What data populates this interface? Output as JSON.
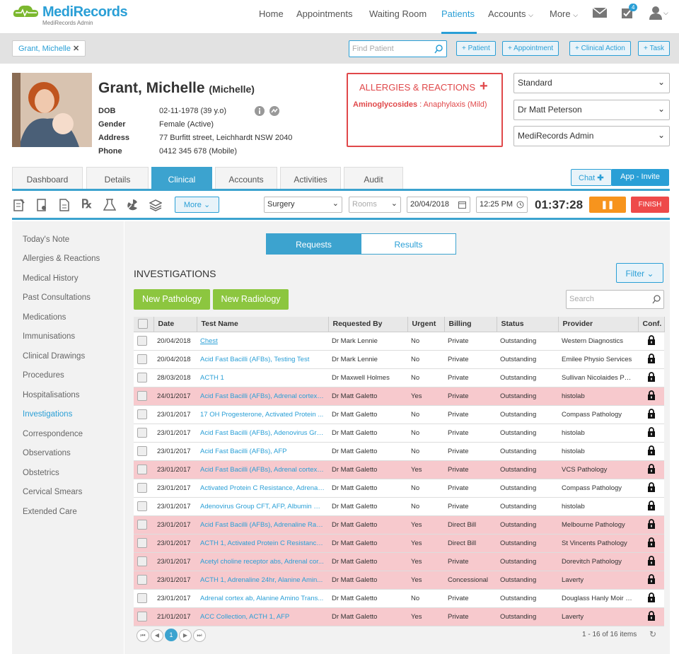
{
  "app": {
    "name_a": "Medi",
    "name_b": "Records",
    "subtitle": "MediRecords Admin"
  },
  "nav": {
    "items": [
      "Home",
      "Appointments",
      "Waiting Room",
      "Patients",
      "Accounts",
      "More"
    ],
    "active": "Patients",
    "task_badge": "4"
  },
  "bar2": {
    "patient_pill": "Grant, Michelle",
    "find_placeholder": "Find Patient",
    "actions": [
      "+ Patient",
      "+ Appointment",
      "+ Clinical Action",
      "+ Task"
    ]
  },
  "patient": {
    "name": "Grant, Michelle",
    "preferred": "(Michelle)",
    "labels": [
      "DOB",
      "Gender",
      "Address",
      "Phone"
    ],
    "values": [
      "02-11-1978 (39 y.o)",
      "Female (Active)",
      "77 Burfitt street, Leichhardt NSW 2040",
      "0412 345 678 (Mobile)"
    ]
  },
  "allergies": {
    "title": "ALLERGIES & REACTIONS",
    "substance": "Aminoglycosides",
    "reaction": " : Anaphylaxis (Mild)"
  },
  "selects": [
    "Standard",
    "Dr Matt Peterson",
    "MediRecords Admin"
  ],
  "tabs": [
    "Dashboard",
    "Details",
    "Clinical",
    "Accounts",
    "Activities",
    "Audit"
  ],
  "active_tab": "Clinical",
  "chat_label": "Chat",
  "app_invite_label": "App - Invite",
  "toolbar": {
    "more_label": "More",
    "location": "Surgery",
    "rooms_placeholder": "Rooms",
    "date": "20/04/2018",
    "time": "12:25 PM",
    "timer": "01:37:28",
    "pause_icon": "❚❚",
    "finish_label": "FINISH"
  },
  "sidebar": {
    "items": [
      "Today's Note",
      "Allergies & Reactions",
      "Medical History",
      "Past Consultations",
      "Medications",
      "Immunisations",
      "Clinical Drawings",
      "Procedures",
      "Hospitalisations",
      "Investigations",
      "Correspondence",
      "Observations",
      "Obstetrics",
      "Cervical Smears",
      "Extended Care"
    ],
    "active": "Investigations"
  },
  "segment": {
    "requests": "Requests",
    "results": "Results"
  },
  "investigations": {
    "title": "INVESTIGATIONS",
    "filter_label": "Filter",
    "new_pathology": "New Pathology",
    "new_radiology": "New Radiology",
    "search_placeholder": "Search",
    "columns": [
      "Date",
      "Test Name",
      "Requested By",
      "Urgent",
      "Billing",
      "Status",
      "Provider",
      "Conf."
    ],
    "rows": [
      [
        "20/04/2018",
        "Chest",
        "Dr Mark Lennie",
        "No",
        "Private",
        "Outstanding",
        "Western Diagnostics"
      ],
      [
        "20/04/2018",
        "Acid Fast Bacilli (AFBs), Testing Test",
        "Dr Mark Lennie",
        "No",
        "Private",
        "Outstanding",
        "Emilee Physio Services"
      ],
      [
        "28/03/2018",
        "ACTH 1",
        "Dr Maxwell Holmes",
        "No",
        "Private",
        "Outstanding",
        "Sullivan Nicolaides Pat..."
      ],
      [
        "24/01/2017",
        "Acid Fast Bacilli (AFBs), Adrenal cortex a...",
        "Dr Matt Galetto",
        "Yes",
        "Private",
        "Outstanding",
        "histolab"
      ],
      [
        "23/01/2017",
        "17 OH Progesterone, Activated Protein ...",
        "Dr Matt Galetto",
        "No",
        "Private",
        "Outstanding",
        "Compass Pathology"
      ],
      [
        "23/01/2017",
        "Acid Fast Bacilli (AFBs), Adenovirus Grou...",
        "Dr Matt Galetto",
        "No",
        "Private",
        "Outstanding",
        "histolab"
      ],
      [
        "23/01/2017",
        "Acid Fast Bacilli (AFBs), AFP",
        "Dr Matt Galetto",
        "No",
        "Private",
        "Outstanding",
        "histolab"
      ],
      [
        "23/01/2017",
        "Acid Fast Bacilli (AFBs), Adrenal cortex a...",
        "Dr Matt Galetto",
        "Yes",
        "Private",
        "Outstanding",
        "VCS Pathology"
      ],
      [
        "23/01/2017",
        "Activated Protein C Resistance, Adrenali...",
        "Dr Matt Galetto",
        "No",
        "Private",
        "Outstanding",
        "Compass Pathology"
      ],
      [
        "23/01/2017",
        "Adenovirus Group CFT, AFP, Albumin Mi...",
        "Dr Matt Galetto",
        "No",
        "Private",
        "Outstanding",
        "histolab"
      ],
      [
        "23/01/2017",
        "Acid Fast Bacilli (AFBs), Adrenaline Rand...",
        "Dr Matt Galetto",
        "Yes",
        "Direct Bill",
        "Outstanding",
        "Melbourne Pathology"
      ],
      [
        "23/01/2017",
        "ACTH 1, Activated Protein C Resistance, ...",
        "Dr Matt Galetto",
        "Yes",
        "Direct Bill",
        "Outstanding",
        "St Vincents Pathology"
      ],
      [
        "23/01/2017",
        "Acetyl choline receptor abs, Adrenal cor...",
        "Dr Matt Galetto",
        "Yes",
        "Private",
        "Outstanding",
        "Dorevitch Pathology"
      ],
      [
        "23/01/2017",
        "ACTH 1, Adrenaline 24hr, Alanine Amin...",
        "Dr Matt Galetto",
        "Yes",
        "Concessional",
        "Outstanding",
        "Laverty"
      ],
      [
        "23/01/2017",
        "Adrenal cortex ab, Alanine Amino Trans...",
        "Dr Matt Galetto",
        "No",
        "Private",
        "Outstanding",
        "Douglass Hanly Moir P..."
      ],
      [
        "21/01/2017",
        "ACC Collection, ACTH 1, AFP",
        "Dr Matt Galetto",
        "Yes",
        "Private",
        "Outstanding",
        "Laverty"
      ]
    ],
    "page": "1",
    "summary": "1 - 16 of 16 items"
  },
  "colors": {
    "accent": "#2a9fd6",
    "tab_active": "#3ca3cf",
    "green": "#8cc63f",
    "alert": "#e0484a",
    "urgent_row": "#f7c9cd",
    "pause": "#f7941d",
    "finish": "#ee4a4a"
  }
}
